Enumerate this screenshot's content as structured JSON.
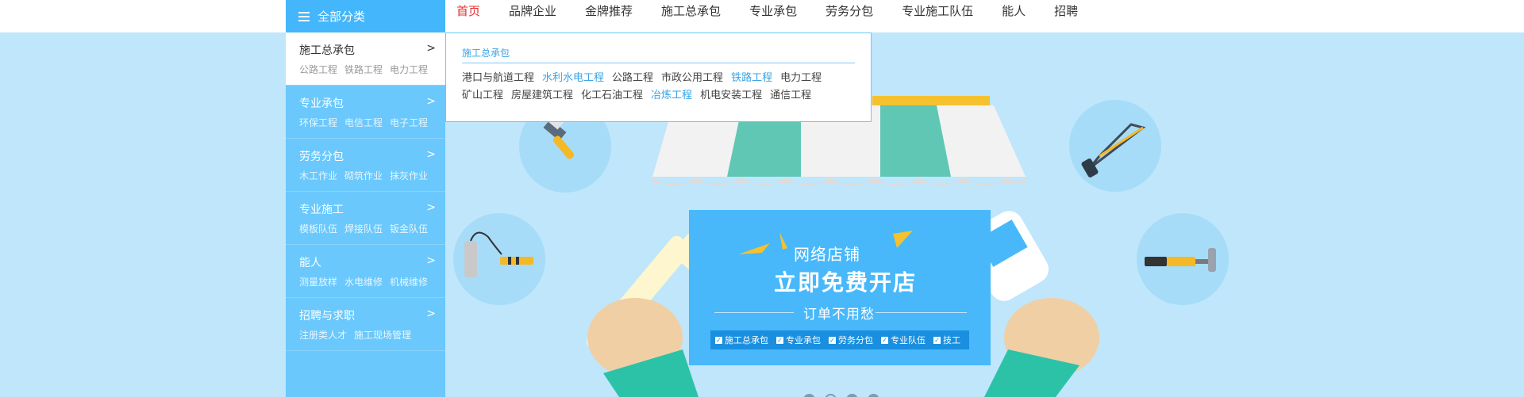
{
  "header": {
    "all_categories": "全部分类",
    "nav": [
      "首页",
      "品牌企业",
      "金牌推荐",
      "施工总承包",
      "专业承包",
      "劳务分包",
      "专业施工队伍",
      "能人",
      "招聘"
    ]
  },
  "categories": [
    {
      "title": "施工总承包",
      "arrow": ">",
      "subs": [
        "公路工程",
        "铁路工程",
        "电力工程"
      ]
    },
    {
      "title": "专业承包",
      "arrow": ">",
      "subs": [
        "环保工程",
        "电信工程",
        "电子工程"
      ]
    },
    {
      "title": "劳务分包",
      "arrow": ">",
      "subs": [
        "木工作业",
        "砌筑作业",
        "抹灰作业"
      ]
    },
    {
      "title": "专业施工",
      "arrow": ">",
      "subs": [
        "模板队伍",
        "焊接队伍",
        "钣金队伍"
      ]
    },
    {
      "title": "能人",
      "arrow": ">",
      "subs": [
        "测量放样",
        "水电维修",
        "机械维修"
      ]
    },
    {
      "title": "招聘与求职",
      "arrow": ">",
      "subs": [
        "注册类人才",
        "施工现场管理"
      ]
    }
  ],
  "dropdown": {
    "title": "施工总承包",
    "links": [
      {
        "text": "港口与航道工程",
        "hl": false
      },
      {
        "text": "水利水电工程",
        "hl": true
      },
      {
        "text": "公路工程",
        "hl": false
      },
      {
        "text": "市政公用工程",
        "hl": false
      },
      {
        "text": "铁路工程",
        "hl": true
      },
      {
        "text": "电力工程",
        "hl": false
      },
      {
        "text": "矿山工程",
        "hl": false
      },
      {
        "text": "房屋建筑工程",
        "hl": false
      },
      {
        "text": "化工石油工程",
        "hl": false
      },
      {
        "text": "冶炼工程",
        "hl": true
      },
      {
        "text": "机电安装工程",
        "hl": false
      },
      {
        "text": "通信工程",
        "hl": false
      }
    ]
  },
  "banner": {
    "line1": "网络店铺",
    "line2": "立即免费开店",
    "line3": "订单不用愁",
    "tags": [
      "施工总承包",
      "专业承包",
      "劳务分包",
      "专业队伍",
      "技工"
    ],
    "check": "✓",
    "slides": 4,
    "active_slide": 2
  },
  "colors": {
    "menu_blue": "#6ac8fc",
    "header_blue": "#44b6fb",
    "banner_bg": "#bfe6fb",
    "active_nav": "#e53030",
    "highlight_link": "#3aa3e6"
  },
  "icons": [
    "menu-icon",
    "paint-brush-icon",
    "paint-roller-icon",
    "hacksaw-icon",
    "screwdriver-icon",
    "hammer-icon",
    "glue-tube-icon"
  ]
}
